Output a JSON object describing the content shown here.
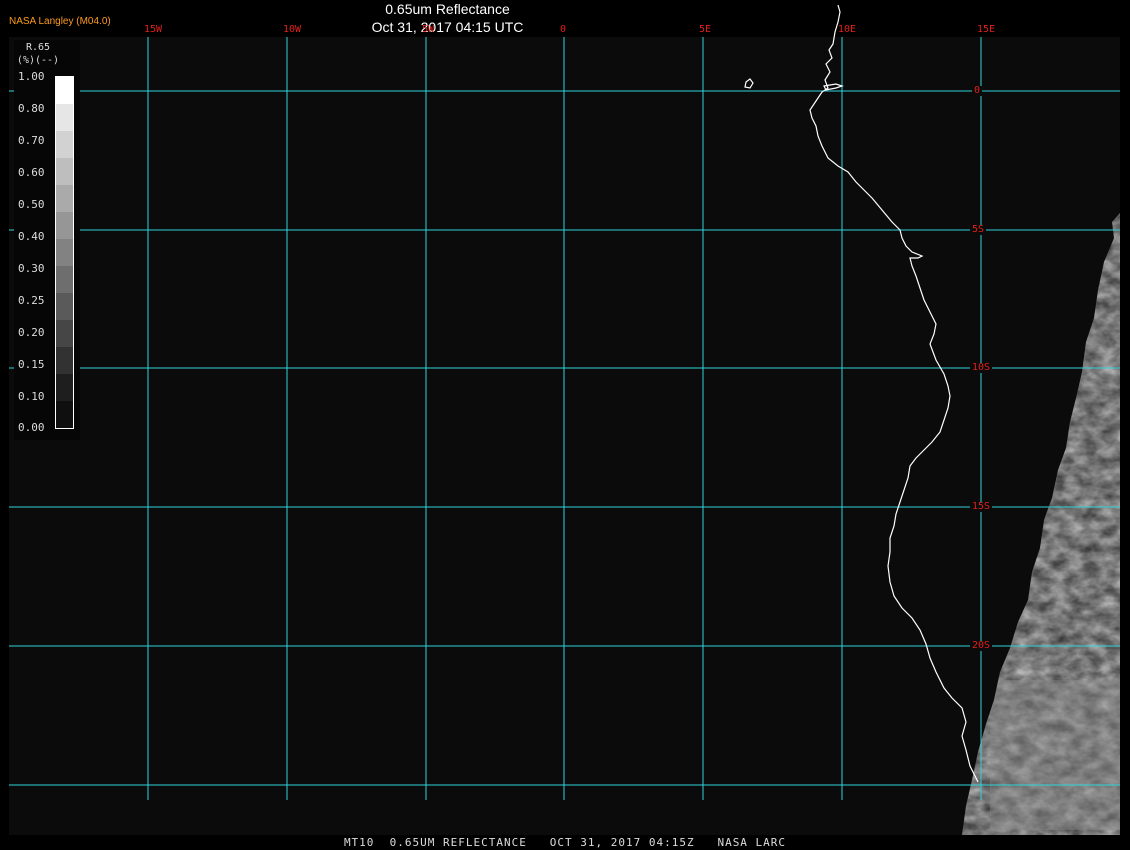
{
  "header": {
    "title": "0.65um Reflectance",
    "datetime": "Oct 31, 2017 04:15 UTC",
    "producer": "NASA Langley (M04.0)"
  },
  "colorbar": {
    "variable": "R.65",
    "units": "(--)",
    "units_prefix": "(%)",
    "ticks": [
      "1.00",
      "0.80",
      "0.70",
      "0.60",
      "0.50",
      "0.40",
      "0.30",
      "0.25",
      "0.20",
      "0.15",
      "0.10",
      "0.00"
    ],
    "gray_levels": [
      "#ffffff",
      "#e6e6e6",
      "#d2d2d2",
      "#bebebe",
      "#aaaaaa",
      "#969696",
      "#828282",
      "#6e6e6e",
      "#5a5a5a",
      "#464646",
      "#323232",
      "#1e1e1e",
      "#0f0f0f"
    ]
  },
  "map": {
    "longitudes": [
      "15W",
      "10W",
      "5W",
      "0",
      "5E",
      "10E",
      "15E"
    ],
    "latitudes": [
      "0",
      "5S",
      "10S",
      "15S",
      "20S"
    ],
    "grid_color": "#2fd3dc",
    "label_color": "#e0201c",
    "coast_color": "#ffffff",
    "background_color": "#0b0b0b"
  },
  "footer": {
    "text": "MT10  0.65UM REFLECTANCE   OCT 31, 2017 04:15Z   NASA LARC"
  }
}
